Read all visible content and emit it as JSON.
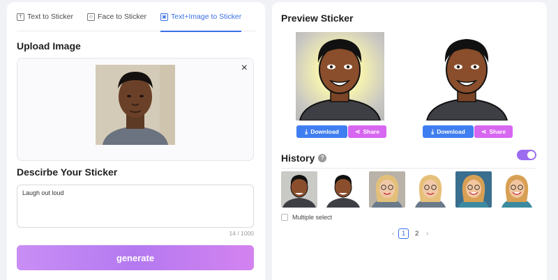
{
  "tabs": [
    {
      "label": "Text to Sticker",
      "icon": "text-icon"
    },
    {
      "label": "Face to Sticker",
      "icon": "face-icon"
    },
    {
      "label": "Text+Image to Sticker",
      "icon": "image-icon",
      "active": true
    }
  ],
  "upload": {
    "title": "Upload Image",
    "close_label": "×"
  },
  "describe": {
    "title": "Descirbe Your Sticker",
    "value": "Laugh out loud",
    "counter": "14 / 1000"
  },
  "generate_label": "generate",
  "preview": {
    "title": "Preview Sticker",
    "cards": [
      {
        "download_label": "Download",
        "share_label": "Share"
      },
      {
        "download_label": "Download",
        "share_label": "Share"
      }
    ]
  },
  "history": {
    "title": "History",
    "help_icon": "?",
    "toggle_on": true,
    "multi_select_label": "Multiple select",
    "thumbnails": [
      "man-sticker",
      "man-sticker",
      "woman-sticker",
      "woman-sticker",
      "woman-sticker",
      "woman-sticker"
    ]
  },
  "pagination": {
    "prev": "‹",
    "pages": [
      "1",
      "2"
    ],
    "current": "1",
    "next": "›"
  },
  "colors": {
    "accent_blue": "#3a6fe8",
    "download_blue": "#3f7ef0",
    "share_pink": "#d766f0",
    "generate_purple": "#b479f0",
    "toggle_purple": "#9b6cf0"
  }
}
